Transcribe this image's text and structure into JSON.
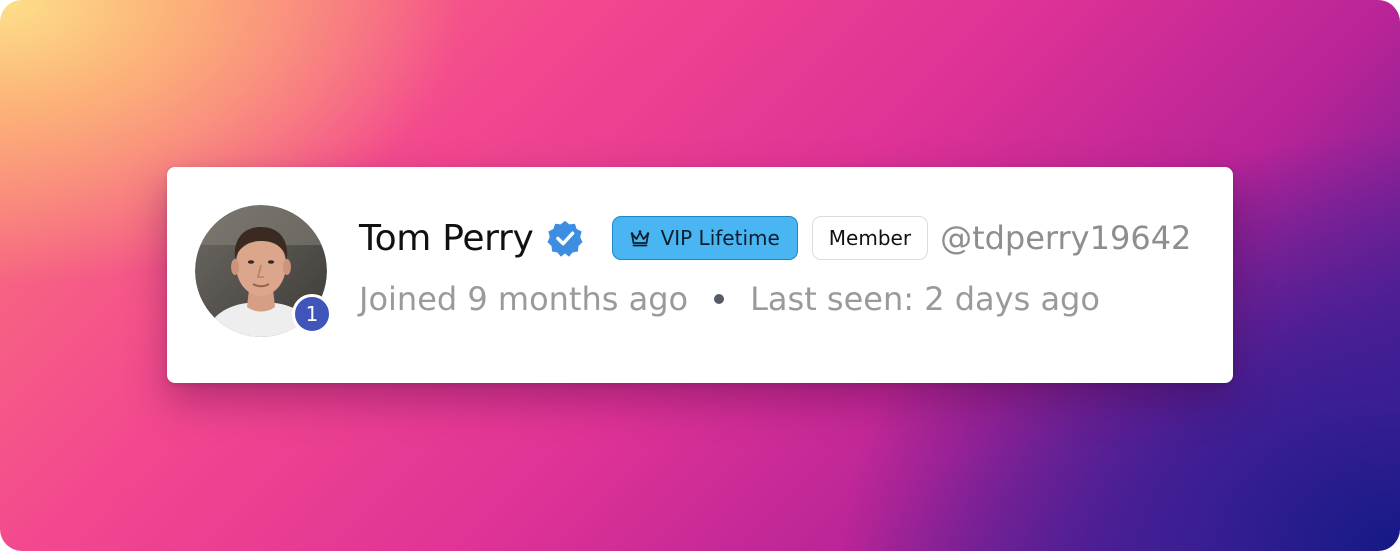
{
  "profile": {
    "name": "Tom Perry",
    "handle": "@tdperry19642",
    "notification_count": "1",
    "joined": "Joined 9 months ago",
    "last_seen": "Last seen: 2 days ago"
  },
  "badges": {
    "vip_label": "VIP Lifetime",
    "vip_icon": "crown-icon",
    "member_label": "Member"
  },
  "icons": {
    "verified": "verified-check-badge-icon"
  },
  "colors": {
    "vip_pill": "#49b5f3",
    "verified_badge": "#3d8ee0",
    "notification_badge": "#3f55b9",
    "secondary_text": "#9a9a9a"
  }
}
